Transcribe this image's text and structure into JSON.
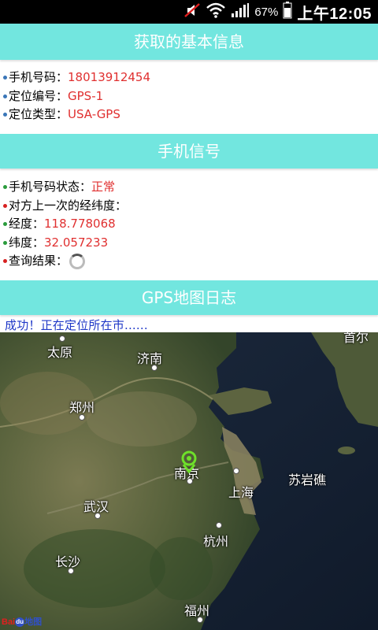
{
  "status_bar": {
    "battery_percent": "67%",
    "time": "上午12:05"
  },
  "section1": {
    "title": "获取的基本信息",
    "rows": [
      {
        "label": "手机号码：",
        "value": "18013912454"
      },
      {
        "label": "定位编号：",
        "value": "GPS-1"
      },
      {
        "label": "定位类型：",
        "value": "USA-GPS"
      }
    ]
  },
  "section2": {
    "title": "手机信号",
    "rows": [
      {
        "label": "手机号码状态：",
        "value": "正常"
      },
      {
        "label": "对方上一次的经纬度：",
        "value": ""
      },
      {
        "label": "经度：",
        "value": "118.778068"
      },
      {
        "label": "纬度：",
        "value": "32.057233"
      },
      {
        "label": "查询结果：",
        "value": ""
      }
    ]
  },
  "section3": {
    "title": "GPS地图日志",
    "log": "成功！正在定位所在市......"
  },
  "map": {
    "cities": [
      "太原",
      "济南",
      "郑州",
      "南京",
      "上海",
      "苏岩礁",
      "武汉",
      "杭州",
      "长沙",
      "福州",
      "首尔"
    ],
    "logo": "Bai",
    "logo_du": "du",
    "logo_map": "地图"
  },
  "colors": {
    "header_bg": "#72e6df",
    "value_red": "#e03030",
    "log_blue": "#1f38c7"
  }
}
